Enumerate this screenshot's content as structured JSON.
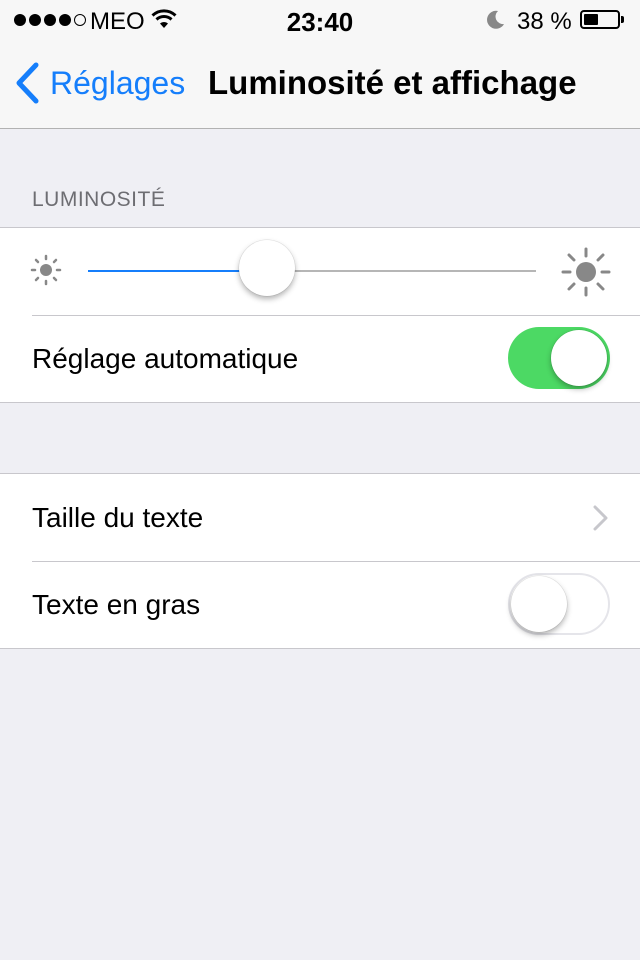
{
  "status_bar": {
    "signal_strength": "4 of 5",
    "carrier": "MEO",
    "time": "23:40",
    "battery_percent": "38 %",
    "icons": [
      "signal-dots-icon",
      "wifi-icon",
      "moon-icon",
      "battery-icon"
    ]
  },
  "nav": {
    "back_label": "Réglages",
    "title": "Luminosité et affichage",
    "back_icon": "chevron-left-icon"
  },
  "brightness_section": {
    "header": "LUMINOSITÉ",
    "slider_value_percent": 40,
    "min_icon": "sun-small-icon",
    "max_icon": "sun-large-icon"
  },
  "rows": {
    "auto_brightness": {
      "label": "Réglage automatique",
      "on": true
    },
    "text_size": {
      "label": "Taille du texte",
      "icon": "chevron-right-icon"
    },
    "bold_text": {
      "label": "Texte en gras",
      "on": false
    }
  },
  "colors": {
    "accent": "#157efb",
    "toggle_on": "#4cd964",
    "background": "#efeff4",
    "section_header": "#6d6d72"
  }
}
